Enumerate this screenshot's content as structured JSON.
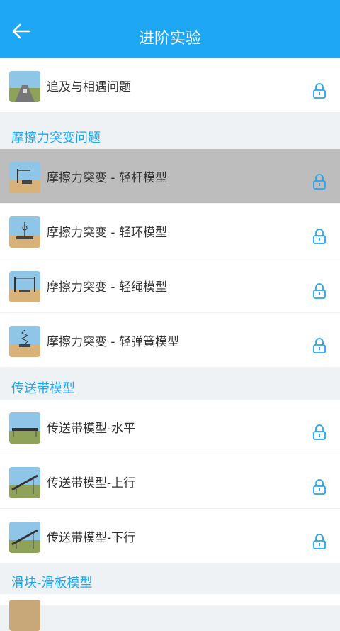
{
  "header": {
    "title": "进阶实验"
  },
  "groups": {
    "first": {
      "items": [
        {
          "label": "追及与相遇问题",
          "locked": true
        }
      ]
    },
    "friction": {
      "title": "摩擦力突变问题",
      "items": [
        {
          "label": "摩擦力突变 - 轻杆模型",
          "locked": true,
          "selected": true
        },
        {
          "label": "摩擦力突变 - 轻环模型",
          "locked": true
        },
        {
          "label": "摩擦力突变 - 轻绳模型",
          "locked": true
        },
        {
          "label": "摩擦力突变 - 轻弹簧模型",
          "locked": true
        }
      ]
    },
    "conveyor": {
      "title": "传送带模型",
      "items": [
        {
          "label": "传送带模型-水平",
          "locked": true
        },
        {
          "label": "传送带模型-上行",
          "locked": true
        },
        {
          "label": "传送带模型-下行",
          "locked": true
        }
      ]
    },
    "slider": {
      "title": "滑块-滑板模型"
    }
  },
  "colors": {
    "accent": "#1ea7f5",
    "selected_bg": "#bdbdbd",
    "divider": "#eef2f5"
  }
}
